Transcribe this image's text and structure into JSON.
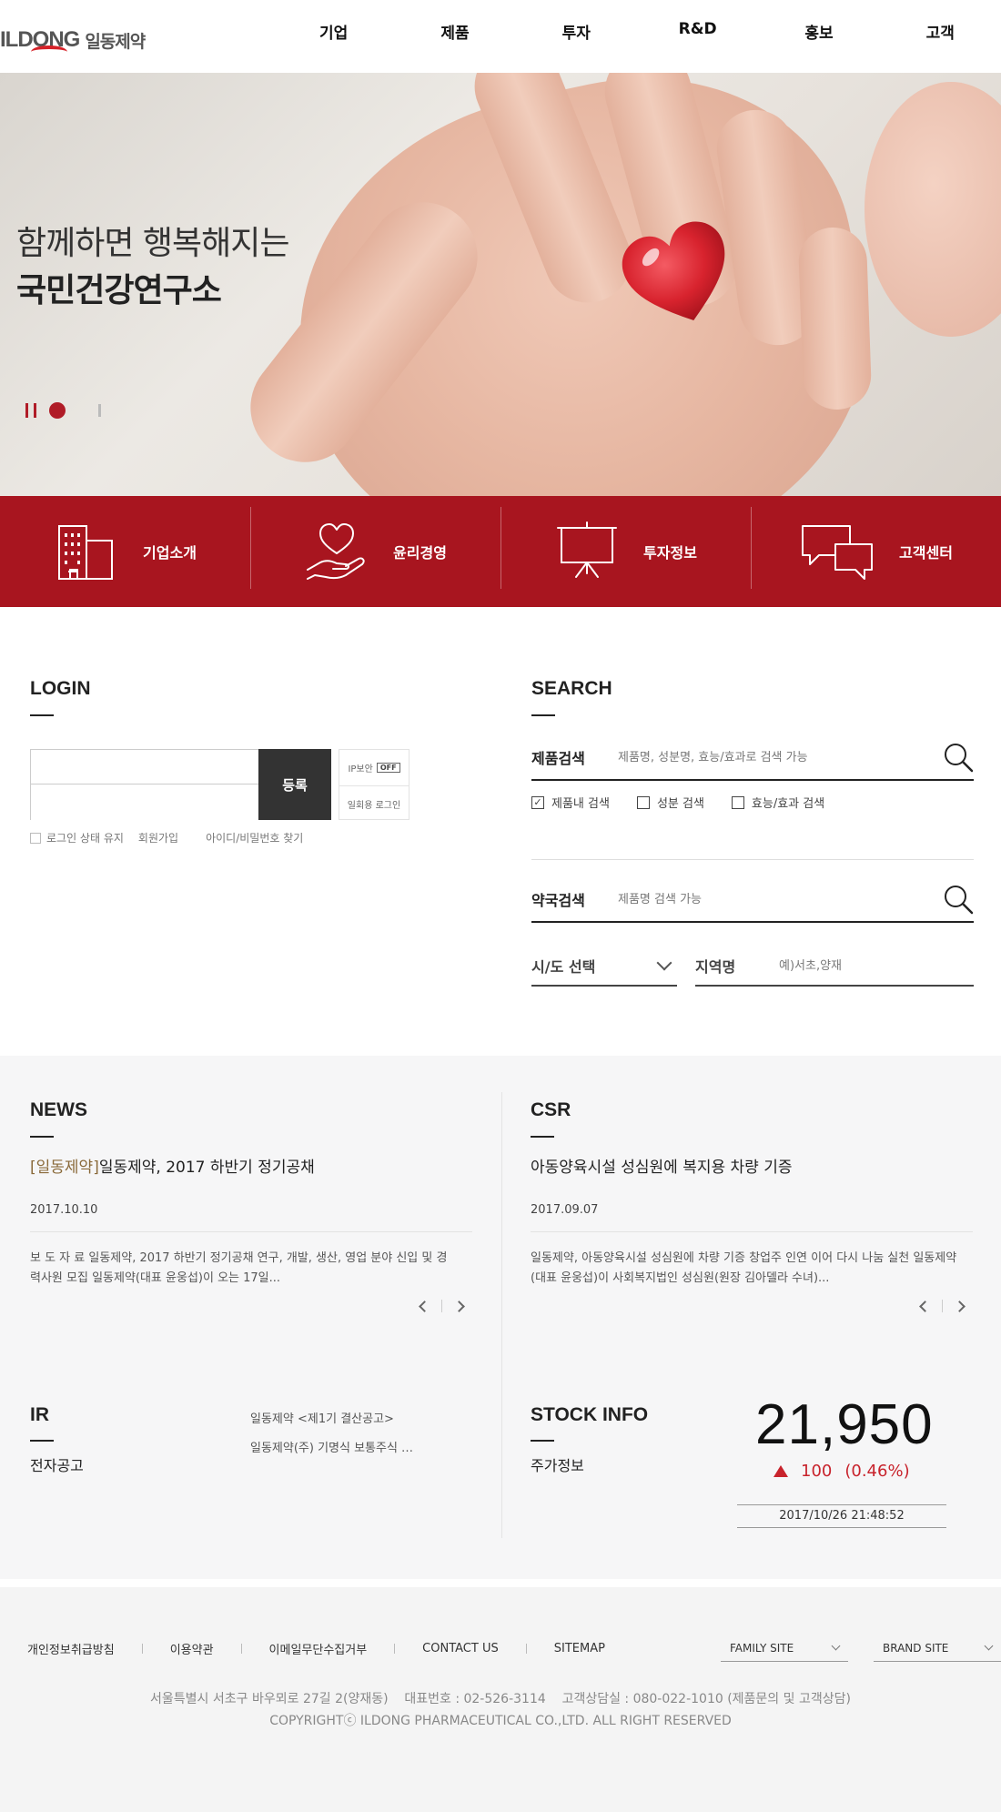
{
  "header": {
    "logo_en": "ILDONG",
    "logo_ko": "일동제약",
    "nav": [
      "기업",
      "제품",
      "투자",
      "R&D",
      "홍보",
      "고객"
    ]
  },
  "hero": {
    "line1": "함께하면 행복해지는",
    "line2": "국민건강연구소"
  },
  "quick": [
    "기업소개",
    "윤리경영",
    "투자정보",
    "고객센터"
  ],
  "login": {
    "title": "LOGIN",
    "id_value": "",
    "pw_value": "",
    "submit_label": "등록",
    "ip_security_label": "IP보안",
    "ip_security_state": "OFF",
    "onetime_login_label": "일회용 로그인",
    "keep_login_label": "로그인 상태 유지",
    "join_label": "회원가입",
    "find_label": "아이디/비밀번호 찾기"
  },
  "search": {
    "title": "SEARCH",
    "product_label": "제품검색",
    "product_placeholder": "제품명, 성분명, 효능/효과로 검색 가능",
    "options": [
      {
        "label": "제품내 검색",
        "checked": true
      },
      {
        "label": "성분 검색",
        "checked": false
      },
      {
        "label": "효능/효과 검색",
        "checked": false
      }
    ],
    "pharmacy_label": "약국검색",
    "pharmacy_placeholder": "제품명 검색 가능",
    "city_select": "시/도 선택",
    "region_label": "지역명",
    "region_placeholder": "예)서초,양재"
  },
  "news": {
    "title": "NEWS",
    "tag": "[일동제약]",
    "headline": "일동제약, 2017 하반기 정기공채",
    "date": "2017.10.10",
    "body": "보 도 자 료 일동제약, 2017 하반기 정기공채 연구, 개발, 생산, 영업 분야 신입 및 경력사원 모집 일동제약(대표 윤웅섭)이 오는 17일..."
  },
  "csr": {
    "title": "CSR",
    "headline": "아동양육시설 성심원에 복지용 차량 기증",
    "date": "2017.09.07",
    "body": "일동제약, 아동양육시설 성심원에 차량 기증 창업주 인연 이어 다시 나눔 실천 일동제약(대표 윤웅섭)이 사회복지법인 성심원(원장 김아델라 수녀)..."
  },
  "ir": {
    "title": "IR",
    "subtitle": "전자공고",
    "items": [
      "일동제약 <제1기 결산공고>",
      "일동제약(주) 기명식 보통주식 …"
    ]
  },
  "stock": {
    "title": "STOCK INFO",
    "subtitle": "주가정보",
    "price": "21,950",
    "change": "100",
    "change_pct": "(0.46%)",
    "direction": "up",
    "timestamp": "2017/10/26 21:48:52",
    "up_color": "#c8232c"
  },
  "footer": {
    "links": [
      "개인정보취급방침",
      "이용약관",
      "이메일무단수집거부",
      "CONTACT US",
      "SITEMAP"
    ],
    "family_site": "FAMILY SITE",
    "brand_site": "BRAND SITE",
    "address": "서울특별시 서초구 바우뫼로 27길 2(양재동)    대표번호 : 02-526-3114    고객상담실 : 080-022-1010 (제품문의 및 고객상담)",
    "copyright": "COPYRIGHTⓒ ILDONG PHARMACEUTICAL CO.,LTD. ALL RIGHT RESERVED"
  },
  "colors": {
    "brand_red": "#a8151f",
    "accent_red": "#b01c27"
  }
}
